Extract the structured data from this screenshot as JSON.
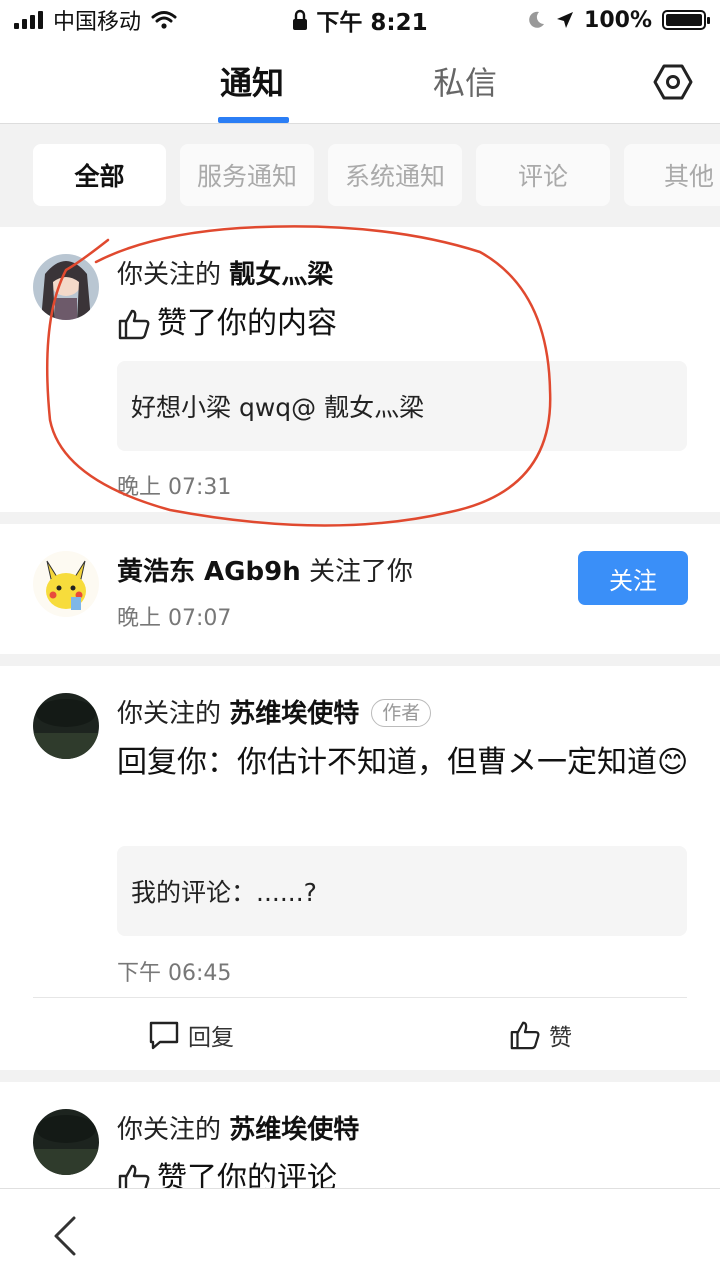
{
  "status_bar": {
    "carrier": "中国移动",
    "time": "下午 8:21",
    "battery": "100%",
    "icons": [
      "signal-icon",
      "wifi-icon",
      "lock-icon",
      "moon-icon",
      "location-icon",
      "battery-icon"
    ]
  },
  "header": {
    "tabs": [
      {
        "label": "通知",
        "active": true
      },
      {
        "label": "私信",
        "active": false
      }
    ],
    "settings_icon": "settings-hexagon-icon",
    "accent_color": "#2b7ef5"
  },
  "filters": [
    {
      "label": "全部",
      "active": true
    },
    {
      "label": "服务通知",
      "active": false
    },
    {
      "label": "系统通知",
      "active": false
    },
    {
      "label": "评论",
      "active": false
    },
    {
      "label": "其他",
      "active": false
    }
  ],
  "notifications": [
    {
      "prefix": "你关注的 ",
      "user": "靓女灬梁",
      "action": "赞了你的内容",
      "quote": "好想小梁 qwq@ 靓女灬梁",
      "time": "晚上 07:31",
      "annotation_color": "#e0492f"
    },
    {
      "user": "黄浩东 AGb9h",
      "action_suffix": " 关注了你",
      "time": "晚上 07:07",
      "follow_label": "关注"
    },
    {
      "prefix": "你关注的 ",
      "user": "苏维埃使特",
      "badge": "作者",
      "reply": "回复你：你估计不知道，但曹メ一定知道",
      "emoji": "😊",
      "quote": "我的评论：......?",
      "time": "下午 06:45",
      "reply_button": "回复",
      "like_button": "赞"
    },
    {
      "prefix": "你关注的 ",
      "user": "苏维埃使特",
      "action": "赞了你的评论"
    }
  ]
}
